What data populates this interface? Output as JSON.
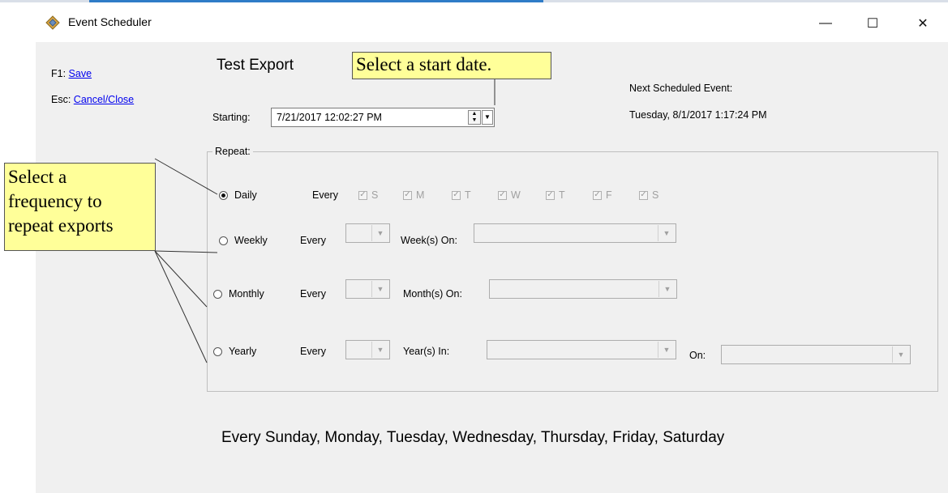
{
  "window": {
    "title": "Event Scheduler",
    "icon": "scheduler-app-icon",
    "controls": {
      "minimize": "—",
      "maximize": "☐",
      "close": "✕"
    }
  },
  "shortcuts": [
    {
      "key": "F1:",
      "label": "Save"
    },
    {
      "key": "Esc:",
      "label": "Cancel/Close"
    }
  ],
  "export_name": "Test Export",
  "starting": {
    "label": "Starting:",
    "value": "7/21/2017 12:02:27 PM"
  },
  "next_event": {
    "label": "Next Scheduled Event:",
    "value": "Tuesday, 8/1/2017 1:17:24 PM"
  },
  "repeat": {
    "legend": "Repeat:",
    "every_label": "Every",
    "daily": {
      "label": "Daily",
      "selected": true
    },
    "days": [
      "S",
      "M",
      "T",
      "W",
      "T",
      "F",
      "S"
    ],
    "weekly": {
      "label": "Weekly",
      "on_label": "Week(s) On:"
    },
    "monthly": {
      "label": "Monthly",
      "on_label": "Month(s) On:"
    },
    "yearly": {
      "label": "Yearly",
      "in_label": "Year(s) In:",
      "on_label": "On:"
    }
  },
  "summary": "Every Sunday, Monday, Tuesday, Wednesday, Thursday, Friday, Saturday",
  "callouts": {
    "start_date": "Select a start date.",
    "frequency_line1": "Select a",
    "frequency_line2": "frequency to",
    "frequency_line3": "repeat exports"
  }
}
